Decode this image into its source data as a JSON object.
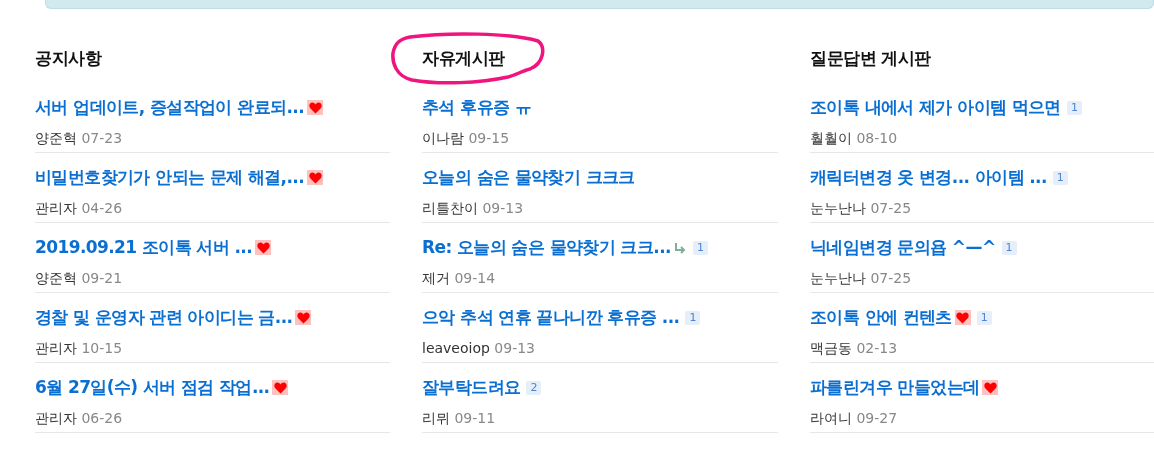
{
  "boards": [
    {
      "title": "공지사항",
      "circled": false,
      "posts": [
        {
          "title": "서버 업데이트, 증설작업이 완료되...",
          "hot": true,
          "reply": false,
          "author": "양준혁",
          "date": "07-23"
        },
        {
          "title": "비밀번호찾기가 안되는 문제 해결,...",
          "hot": true,
          "reply": false,
          "author": "관리자",
          "date": "04-26"
        },
        {
          "title": "2019.09.21 조이톡 서버 ...",
          "hot": true,
          "reply": false,
          "author": "양준혁",
          "date": "09-21"
        },
        {
          "title": "경찰 및 운영자 관련 아이디는 금...",
          "hot": true,
          "reply": false,
          "author": "관리자",
          "date": "10-15"
        },
        {
          "title": "6월 27일(수) 서버 점검 작업...",
          "hot": true,
          "reply": false,
          "author": "관리자",
          "date": "06-26"
        }
      ]
    },
    {
      "title": "자유게시판",
      "circled": true,
      "posts": [
        {
          "title": "추석 후유증 ㅠ",
          "hot": false,
          "reply": false,
          "author": "이나람",
          "date": "09-15"
        },
        {
          "title": "오늘의 숨은 물약찾기 크크크",
          "hot": false,
          "reply": false,
          "author": "리틀찬이",
          "date": "09-13"
        },
        {
          "title": "Re: 오늘의 숨은 물약찾기 크크...",
          "hot": false,
          "reply": true,
          "comments": "1",
          "author": "제거",
          "date": "09-14"
        },
        {
          "title": "으악 추석 연휴 끝나니깐 후유증 ...",
          "hot": false,
          "reply": false,
          "comments": "1",
          "author": "leaveoiop",
          "date": "09-13"
        },
        {
          "title": "잘부탁드려요",
          "hot": false,
          "reply": false,
          "comments": "2",
          "author": "리뮈",
          "date": "09-11"
        }
      ]
    },
    {
      "title": "질문답변 게시판",
      "circled": false,
      "posts": [
        {
          "title": "조이톡 내에서 제가 아이템 먹으면",
          "hot": false,
          "reply": false,
          "comments": "1",
          "author": "훨훨이",
          "date": "08-10"
        },
        {
          "title": "캐릭터변경 옷 변경... 아이템 ...",
          "hot": false,
          "reply": false,
          "comments": "1",
          "author": "눈누난나",
          "date": "07-25"
        },
        {
          "title": "닉네임변경 문의욥 ^—^",
          "hot": false,
          "reply": false,
          "comments": "1",
          "author": "눈누난나",
          "date": "07-25"
        },
        {
          "title": "조이톡 안에 컨텐츠",
          "hot": true,
          "reply": false,
          "comments": "1",
          "author": "맥금동",
          "date": "02-13"
        },
        {
          "title": "파를린겨우 만들었는데",
          "hot": true,
          "reply": false,
          "author": "라여니",
          "date": "09-27"
        }
      ]
    }
  ]
}
